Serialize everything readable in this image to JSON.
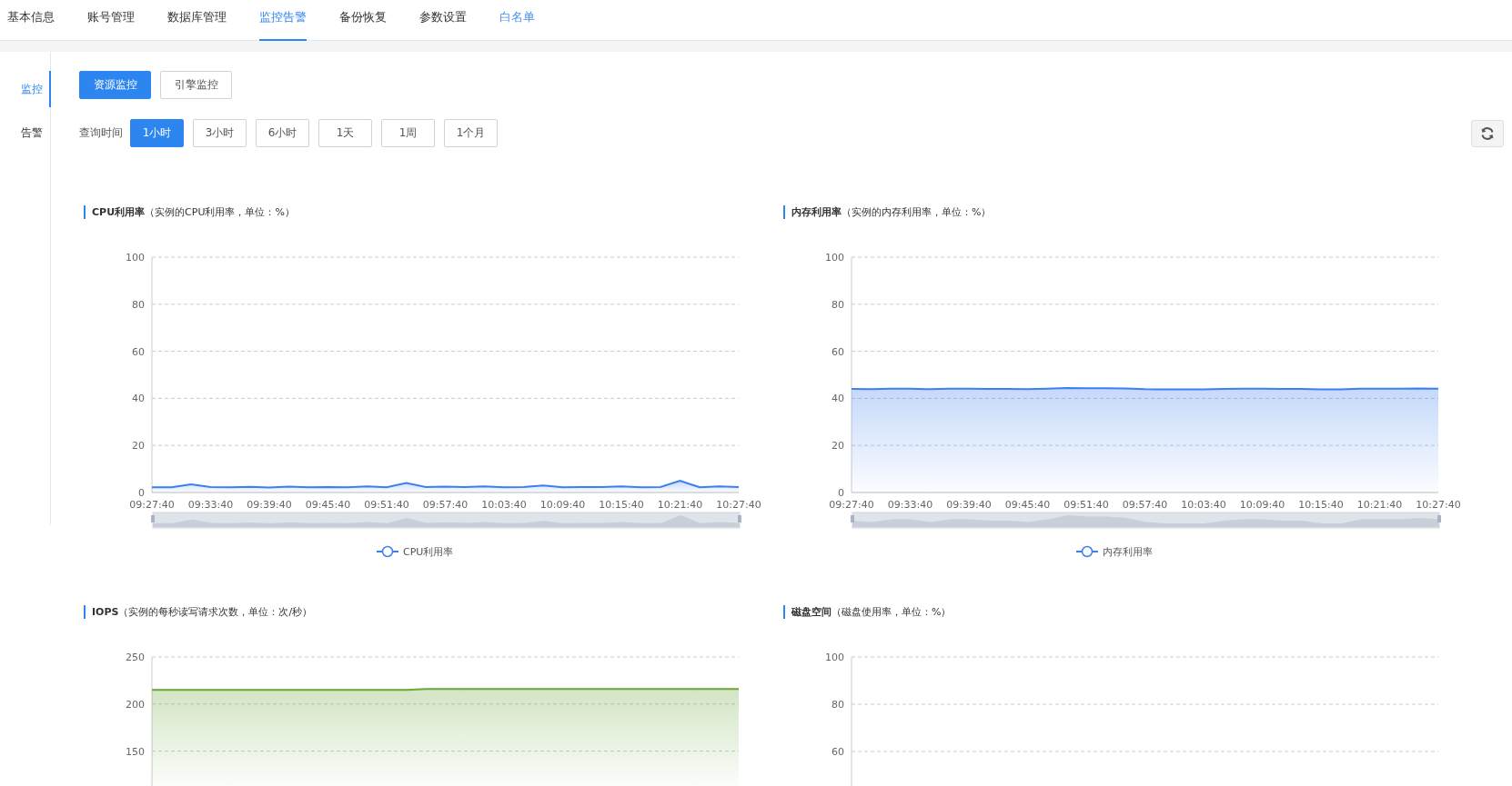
{
  "top_tabs": [
    {
      "label": "基本信息",
      "selected": false,
      "kind": "tab"
    },
    {
      "label": "账号管理",
      "selected": false,
      "kind": "tab"
    },
    {
      "label": "数据库管理",
      "selected": false,
      "kind": "tab"
    },
    {
      "label": "监控告警",
      "selected": true,
      "kind": "tab"
    },
    {
      "label": "备份恢复",
      "selected": false,
      "kind": "tab"
    },
    {
      "label": "参数设置",
      "selected": false,
      "kind": "tab"
    },
    {
      "label": "白名单",
      "selected": false,
      "kind": "link"
    }
  ],
  "sidebar": {
    "items": [
      {
        "label": "监控",
        "selected": true
      },
      {
        "label": "告警",
        "selected": false
      }
    ]
  },
  "monitor_types": [
    {
      "label": "资源监控",
      "selected": true
    },
    {
      "label": "引擎监控",
      "selected": false
    }
  ],
  "time_range": {
    "label": "查询时间",
    "options": [
      {
        "label": "1小时",
        "selected": true
      },
      {
        "label": "3小时",
        "selected": false
      },
      {
        "label": "6小时",
        "selected": false
      },
      {
        "label": "1天",
        "selected": false
      },
      {
        "label": "1周",
        "selected": false
      },
      {
        "label": "1个月",
        "selected": false
      }
    ]
  },
  "charts": [
    {
      "title": "**CPU利用率**（实例的CPU利用率，单位：%）",
      "chart_data": {
        "type": "area",
        "grid": true,
        "categories": [
          "09:27:40",
          null,
          null,
          "09:33:40",
          null,
          null,
          "09:39:40",
          null,
          null,
          "09:45:40",
          null,
          null,
          "09:51:40",
          null,
          null,
          "09:57:40",
          null,
          null,
          "10:03:40",
          null,
          null,
          "10:09:40",
          null,
          null,
          "10:15:40",
          null,
          null,
          "10:21:40",
          null,
          null,
          "10:27:40"
        ],
        "ylim": [
          0,
          100
        ],
        "yticks": [
          0,
          20,
          40,
          60,
          80,
          100
        ],
        "series": [
          {
            "name": "CPU利用率",
            "color": "#3d7ff0",
            "values": [
              2.2,
              2.2,
              3.5,
              2.3,
              2.2,
              2.4,
              2.1,
              2.5,
              2.2,
              2.3,
              2.2,
              2.6,
              2.2,
              4.0,
              2.3,
              2.5,
              2.3,
              2.6,
              2.2,
              2.3,
              3.0,
              2.2,
              2.3,
              2.3,
              2.6,
              2.2,
              2.3,
              5.0,
              2.2,
              2.6,
              2.3
            ]
          }
        ]
      }
    },
    {
      "title": "**内存利用率**（实例的内存利用率，单位：%）",
      "chart_data": {
        "type": "area",
        "grid": true,
        "categories": [
          "09:27:40",
          null,
          null,
          "09:33:40",
          null,
          null,
          "09:39:40",
          null,
          null,
          "09:45:40",
          null,
          null,
          "09:51:40",
          null,
          null,
          "09:57:40",
          null,
          null,
          "10:03:40",
          null,
          null,
          "10:09:40",
          null,
          null,
          "10:15:40",
          null,
          null,
          "10:21:40",
          null,
          null,
          "10:27:40"
        ],
        "ylim": [
          0,
          100
        ],
        "yticks": [
          0,
          20,
          40,
          60,
          80,
          100
        ],
        "series": [
          {
            "name": "内存利用率",
            "color": "#3d7ff0",
            "values": [
              44.0,
              43.9,
              44.1,
              44.1,
              43.9,
              44.1,
              44.1,
              44.0,
              44.0,
              43.9,
              44.1,
              44.4,
              44.3,
              44.3,
              44.2,
              43.9,
              43.8,
              43.8,
              43.8,
              44.0,
              44.1,
              44.1,
              44.0,
              44.0,
              43.8,
              43.8,
              44.1,
              44.1,
              44.1,
              44.2,
              44.1
            ]
          }
        ]
      }
    },
    {
      "title": "**IOPS**（实例的每秒读写请求次数，单位：次/秒）",
      "chart_data": {
        "type": "area",
        "grid": true,
        "ylim": [
          0,
          250
        ],
        "yticks": [
          150,
          200,
          250
        ],
        "series": [
          {
            "color": "#6aa83a",
            "values": [
              215,
              215,
              215,
              215,
              215,
              215,
              215,
              215,
              215,
              215,
              215,
              215,
              215,
              215,
              216,
              216,
              216,
              216,
              216,
              216,
              216,
              216,
              216,
              216,
              216,
              216,
              216,
              216,
              216,
              216,
              216
            ]
          }
        ]
      }
    },
    {
      "title": "**磁盘空间**（磁盘使用率，单位：%）",
      "empty_plot": {
        "y_axis_labels": [
          "100",
          "80",
          "60"
        ]
      }
    }
  ]
}
